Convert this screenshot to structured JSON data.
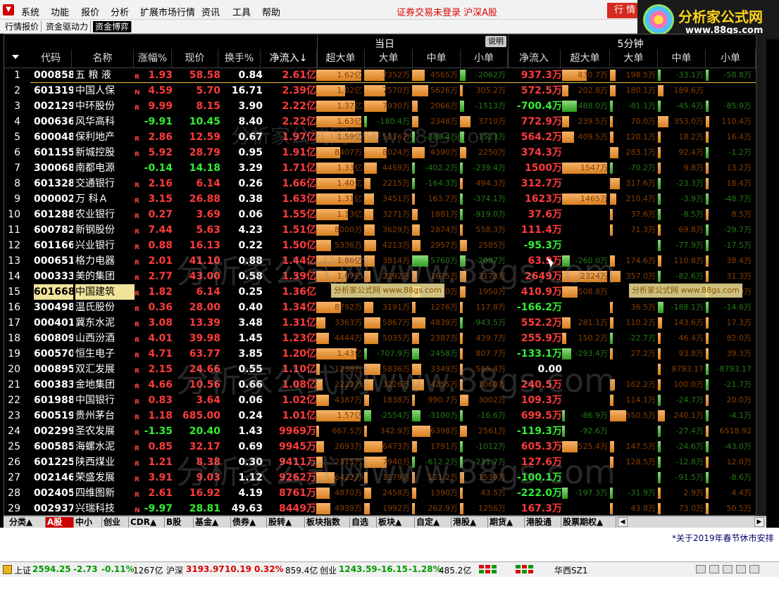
{
  "menu": {
    "items": [
      "系统",
      "功能",
      "报价",
      "分析",
      "扩展市场行情",
      "资讯",
      "工具",
      "帮助"
    ],
    "status": "证券交易未登录  沪深A股",
    "trade_btn": "行 情"
  },
  "logo": {
    "title": "分析家公式网",
    "url": "www.88gs.com"
  },
  "subtabs": [
    "行情报价",
    "资金驱动力",
    "资金博弈"
  ],
  "header": {
    "group_today": "当日",
    "group_5min": "5分钟",
    "explain_btn": "说明",
    "cols": [
      "代码",
      "名称",
      "涨幅%",
      "现价",
      "换手%",
      "净流入↓",
      "超大单",
      "大单",
      "中单",
      "小单",
      "净流入",
      "超大单",
      "大单",
      "中单",
      "小单"
    ]
  },
  "rows": [
    {
      "i": "1",
      "code": "000858",
      "name": "五 粮 液",
      "flag": "R",
      "pct": "1.93",
      "price": "58.58",
      "turn": "0.84",
      "net": "2.61亿",
      "v": [
        "1.62亿",
        "7352万",
        "4565万",
        "-2062万"
      ],
      "net5": "937.3万",
      "v5": [
        "830.7万",
        "198.5万",
        "-33.1万",
        "-58.8万"
      ]
    },
    {
      "i": "2",
      "code": "601319",
      "name": "中国人保",
      "flag": "N",
      "pct": "4.59",
      "price": "5.70",
      "turn": "16.71",
      "net": "2.39亿",
      "v": [
        "1.02亿",
        "7570万",
        "5626万",
        "305.2万"
      ],
      "net5": "572.5万",
      "v5": [
        "202.8万",
        "180.1万",
        "189.6万",
        ""
      ]
    },
    {
      "i": "3",
      "code": "002129",
      "name": "中环股份",
      "flag": "R",
      "pct": "9.99",
      "price": "8.15",
      "turn": "3.90",
      "net": "2.22亿",
      "v": [
        "1.37亿",
        "7930万",
        "2066万",
        "-1513万"
      ],
      "net5": "-700.4万",
      "v5": [
        "-488.0万",
        "-81.1万",
        "-45.4万",
        "-85.9万"
      ]
    },
    {
      "i": "4",
      "code": "000636",
      "name": "风华高科",
      "flag": "",
      "pct": "-9.91",
      "price": "10.45",
      "turn": "8.40",
      "net": "2.22亿",
      "v": [
        "1.63亿",
        "-180.4万",
        "2348万",
        "3710万"
      ],
      "net5": "772.9万",
      "v5": [
        "239.5万",
        "70.0万",
        "353.0万",
        "110.4万"
      ]
    },
    {
      "i": "5",
      "code": "600048",
      "name": "保利地产",
      "flag": "R",
      "pct": "2.86",
      "price": "12.59",
      "turn": "0.67",
      "net": "1.97亿",
      "v": [
        "1.59亿",
        "5116万",
        "-388.4万",
        "-1523万"
      ],
      "net5": "564.2万",
      "v5": [
        "409.5万",
        "120.1万",
        "18.2万",
        "16.4万"
      ]
    },
    {
      "i": "6",
      "code": "601155",
      "name": "新城控股",
      "flag": "R",
      "pct": "5.92",
      "price": "28.79",
      "turn": "0.95",
      "net": "1.91亿",
      "v": [
        "8407万",
        "8024万",
        "4390万",
        "2250万"
      ],
      "net5": "374.3万",
      "v5": [
        "",
        "283.1万",
        "92.4万",
        "-1.2万"
      ]
    },
    {
      "i": "7",
      "code": "300068",
      "name": "南都电源",
      "flag": "",
      "pct": "-0.14",
      "price": "14.18",
      "turn": "3.29",
      "net": "1.71亿",
      "v": [
        "1.33亿",
        "4459万",
        "-402.2万",
        "-239.4万"
      ],
      "net5": "1500万",
      "v5": [
        "1547万",
        "-70.2万",
        "9.8万",
        "13.2万"
      ]
    },
    {
      "i": "8",
      "code": "601328",
      "name": "交通银行",
      "flag": "R",
      "pct": "2.16",
      "price": "6.14",
      "turn": "0.26",
      "net": "1.66亿",
      "v": [
        "1.40亿",
        "2215万",
        "-164.3万",
        "494.3万"
      ],
      "net5": "312.7万",
      "v5": [
        "",
        "317.6万",
        "-23.3万",
        "18.4万"
      ]
    },
    {
      "i": "9",
      "code": "000002",
      "name": "万 科Ａ",
      "flag": "R",
      "pct": "3.15",
      "price": "26.88",
      "turn": "0.38",
      "net": "1.63亿",
      "v": [
        "1.31亿",
        "3451万",
        "163.7万",
        "-374.1万"
      ],
      "net5": "1623万",
      "v5": [
        "1465万",
        "210.4万",
        "-3.9万",
        "-48.7万"
      ]
    },
    {
      "i": "10",
      "code": "601288",
      "name": "农业银行",
      "flag": "R",
      "pct": "0.27",
      "price": "3.69",
      "turn": "0.06",
      "net": "1.55亿",
      "v": [
        "1.13亿",
        "3271万",
        "1881万",
        "-919.0万"
      ],
      "net5": "37.6万",
      "v5": [
        "",
        "37.6万",
        "-8.5万",
        "8.5万"
      ]
    },
    {
      "i": "11",
      "code": "600782",
      "name": "新钢股份",
      "flag": "R",
      "pct": "7.44",
      "price": "5.63",
      "turn": "4.23",
      "net": "1.51亿",
      "v": [
        "8000万",
        "3629万",
        "2874万",
        "558.3万"
      ],
      "net5": "111.4万",
      "v5": [
        "",
        "71.3万",
        "69.8万",
        "-29.7万"
      ]
    },
    {
      "i": "12",
      "code": "601166",
      "name": "兴业银行",
      "flag": "R",
      "pct": "0.88",
      "price": "16.13",
      "turn": "0.22",
      "net": "1.50亿",
      "v": [
        "5336万",
        "4213万",
        "2957万",
        "2585万"
      ],
      "net5": "-95.3万",
      "v5": [
        "",
        "",
        "-77.9万",
        "-17.5万"
      ]
    },
    {
      "i": "13",
      "code": "000651",
      "name": "格力电器",
      "flag": "R",
      "pct": "2.01",
      "price": "41.10",
      "turn": "0.88",
      "net": "1.44亿",
      "v": [
        "1.86亿",
        "3814万",
        "-5760万",
        "-2087万"
      ],
      "net5": "63.9万",
      "v5": [
        "-260.0万",
        "174.6万",
        "110.8万",
        "38.4万"
      ]
    },
    {
      "i": "14",
      "code": "000333",
      "name": "美的集团",
      "flag": "R",
      "pct": "2.77",
      "price": "43.00",
      "turn": "0.58",
      "net": "1.39亿",
      "v": [
        "1.07亿",
        "2192万",
        "1675万",
        "2173万"
      ],
      "net5": "2649万",
      "v5": [
        "2324万",
        "357.0万",
        "-82.6万",
        "31.3万"
      ]
    },
    {
      "i": "15",
      "code": "601668",
      "name": "中国建筑",
      "flag": "R",
      "pct": "1.82",
      "price": "6.14",
      "turn": "0.25",
      "net": "1.36亿",
      "v": [
        "",
        "",
        "3010万",
        "1950万"
      ],
      "net5": "410.9万",
      "v5": [
        "508.8万",
        "",
        "",
        "9.9万"
      ]
    },
    {
      "i": "16",
      "code": "300498",
      "name": "温氏股份",
      "flag": "R",
      "pct": "0.36",
      "price": "28.00",
      "turn": "0.40",
      "net": "1.34亿",
      "v": [
        "8792万",
        "3191万",
        "1276万",
        "117.8万"
      ],
      "net5": "-166.2万",
      "v5": [
        "",
        "36.5万",
        "-188.1万",
        "-14.6万"
      ]
    },
    {
      "i": "17",
      "code": "000401",
      "name": "冀东水泥",
      "flag": "R",
      "pct": "3.08",
      "price": "13.39",
      "turn": "3.48",
      "net": "1.31亿",
      "v": [
        "3363万",
        "5867万",
        "4839万",
        "-943.5万"
      ],
      "net5": "552.2万",
      "v5": [
        "281.1万",
        "110.2万",
        "143.6万",
        "17.3万"
      ]
    },
    {
      "i": "18",
      "code": "600809",
      "name": "山西汾酒",
      "flag": "R",
      "pct": "4.01",
      "price": "39.98",
      "turn": "1.45",
      "net": "1.23亿",
      "v": [
        "4444万",
        "5035万",
        "2387万",
        "439.7万"
      ],
      "net5": "255.9万",
      "v5": [
        "150.2万",
        "-22.7万",
        "46.4万",
        "82.0万"
      ]
    },
    {
      "i": "19",
      "code": "600570",
      "name": "恒生电子",
      "flag": "R",
      "pct": "4.71",
      "price": "63.77",
      "turn": "3.85",
      "net": "1.20亿",
      "v": [
        "1.43亿",
        "-707.9万",
        "-2458万",
        "807.7万"
      ],
      "net5": "-133.1万",
      "v5": [
        "-293.4万",
        "27.2万",
        "93.8万",
        "39.3万"
      ]
    },
    {
      "i": "20",
      "code": "000895",
      "name": "双汇发展",
      "flag": "R",
      "pct": "2.15",
      "price": "24.66",
      "turn": "0.55",
      "net": "1.10亿",
      "v": [
        "1238万",
        "5836万",
        "3349万",
        "565.4万"
      ],
      "net5": "0.00",
      "v5": [
        "",
        "",
        "8793.17",
        "-8793.17"
      ]
    },
    {
      "i": "21",
      "code": "600383",
      "name": "金地集团",
      "flag": "R",
      "pct": "4.66",
      "price": "10.56",
      "turn": "0.66",
      "net": "1.08亿",
      "v": [
        "2222万",
        "3226万",
        "4255万",
        "1060万"
      ],
      "net5": "240.5万",
      "v5": [
        "",
        "162.2万",
        "100.0万",
        "-21.7万"
      ]
    },
    {
      "i": "22",
      "code": "601988",
      "name": "中国银行",
      "flag": "R",
      "pct": "0.83",
      "price": "3.64",
      "turn": "0.06",
      "net": "1.02亿",
      "v": [
        "4387万",
        "1838万",
        "990.7万",
        "3002万"
      ],
      "net5": "109.3万",
      "v5": [
        "",
        "114.1万",
        "-24.7万",
        "20.0万"
      ]
    },
    {
      "i": "23",
      "code": "600519",
      "name": "贵州茅台",
      "flag": "R",
      "pct": "1.18",
      "price": "685.00",
      "turn": "0.24",
      "net": "1.01亿",
      "v": [
        "1.57亿",
        "-2554万",
        "-3100万",
        "-16.6万"
      ],
      "net5": "699.5万",
      "v5": [
        "-86.9万",
        "550.5万",
        "240.1万",
        "-4.1万"
      ]
    },
    {
      "i": "24",
      "code": "002299",
      "name": "圣农发展",
      "flag": "R",
      "pct": "-1.35",
      "price": "20.40",
      "turn": "1.43",
      "net": "9969万",
      "v": [
        "667.5万",
        "342.9万",
        "6398万",
        "2561万"
      ],
      "net5": "-119.3万",
      "v5": [
        "-92.6万",
        "",
        "-27.4万",
        "6518.92"
      ]
    },
    {
      "i": "25",
      "code": "600585",
      "name": "海螺水泥",
      "flag": "R",
      "pct": "0.85",
      "price": "32.17",
      "turn": "0.69",
      "net": "9945万",
      "v": [
        "2693万",
        "6473万",
        "1791万",
        "-1012万"
      ],
      "net5": "605.3万",
      "v5": [
        "525.4万",
        "147.5万",
        "-24.6万",
        "-43.0万"
      ]
    },
    {
      "i": "26",
      "code": "601225",
      "name": "陕西煤业",
      "flag": "R",
      "pct": "1.21",
      "price": "8.38",
      "turn": "0.30",
      "net": "9411万",
      "v": [
        "2315万",
        "7940万",
        "-612.2万",
        "-231.7万"
      ],
      "net5": "127.6万",
      "v5": [
        "",
        "128.5万",
        "-12.8万",
        "12.0万"
      ]
    },
    {
      "i": "27",
      "code": "002146",
      "name": "荣盛发展",
      "flag": "R",
      "pct": "3.91",
      "price": "9.03",
      "turn": "1.12",
      "net": "9262万",
      "v": [
        "6422万",
        "1179万",
        "121.2万",
        "1539万"
      ],
      "net5": "-100.1万",
      "v5": [
        "",
        "",
        "-91.5万",
        "-8.6万"
      ]
    },
    {
      "i": "28",
      "code": "002405",
      "name": "四维图新",
      "flag": "R",
      "pct": "2.61",
      "price": "16.92",
      "turn": "4.19",
      "net": "8761万",
      "v": [
        "4870万",
        "2458万",
        "1390万",
        "43.5万"
      ],
      "net5": "-222.0万",
      "v5": [
        "-197.3万",
        "-31.9万",
        "2.9万",
        "4.4万"
      ]
    },
    {
      "i": "29",
      "code": "002937",
      "name": "兴瑞科技",
      "flag": "N",
      "pct": "-9.97",
      "price": "28.81",
      "turn": "49.63",
      "net": "8449万",
      "v": [
        "4939万",
        "1992万",
        "262.9万",
        "1256万"
      ],
      "net5": "167.3万",
      "v5": [
        "",
        "43.8万",
        "73.0万",
        "50.5万"
      ]
    }
  ],
  "bottom_tabs": [
    "分类▲",
    "A股",
    "中小",
    "创业",
    "CDR▲",
    "B股",
    "基金▲",
    "债券▲",
    "股转▲",
    "板块指数",
    "自选",
    "板块▲",
    "自定▲",
    "港股▲",
    "期货▲",
    "港股通",
    "股票期权▲"
  ],
  "notice": "*关于2019年春节休市安排",
  "statusbar": {
    "sh_label": "上证",
    "sh_val": "2594.25",
    "sh_chg": "-2.73",
    "sh_pct": "-0.11%",
    "sh_amt": "1267亿",
    "hs_label": "沪深",
    "hs_val": "3193.97",
    "hs_chg": "10.19",
    "hs_pct": "0.32%",
    "hs_amt": "859.4亿",
    "cy_label": "创业",
    "cy_val": "1243.59",
    "cy_chg": "-16.15",
    "cy_pct": "-1.28%",
    "cy_amt": "485.2亿",
    "server": "华西SZ1"
  },
  "watermarks": {
    "big": "分析家公式网www.88gs.com",
    "small": "分析家公式网 www.88gs.com"
  },
  "colors": {
    "up": "#ff3b3b",
    "down": "#33ee33",
    "bar_pos": "#e08a2a",
    "bar_neg": "#3aa82a",
    "selected_row": "#f1e39a"
  }
}
